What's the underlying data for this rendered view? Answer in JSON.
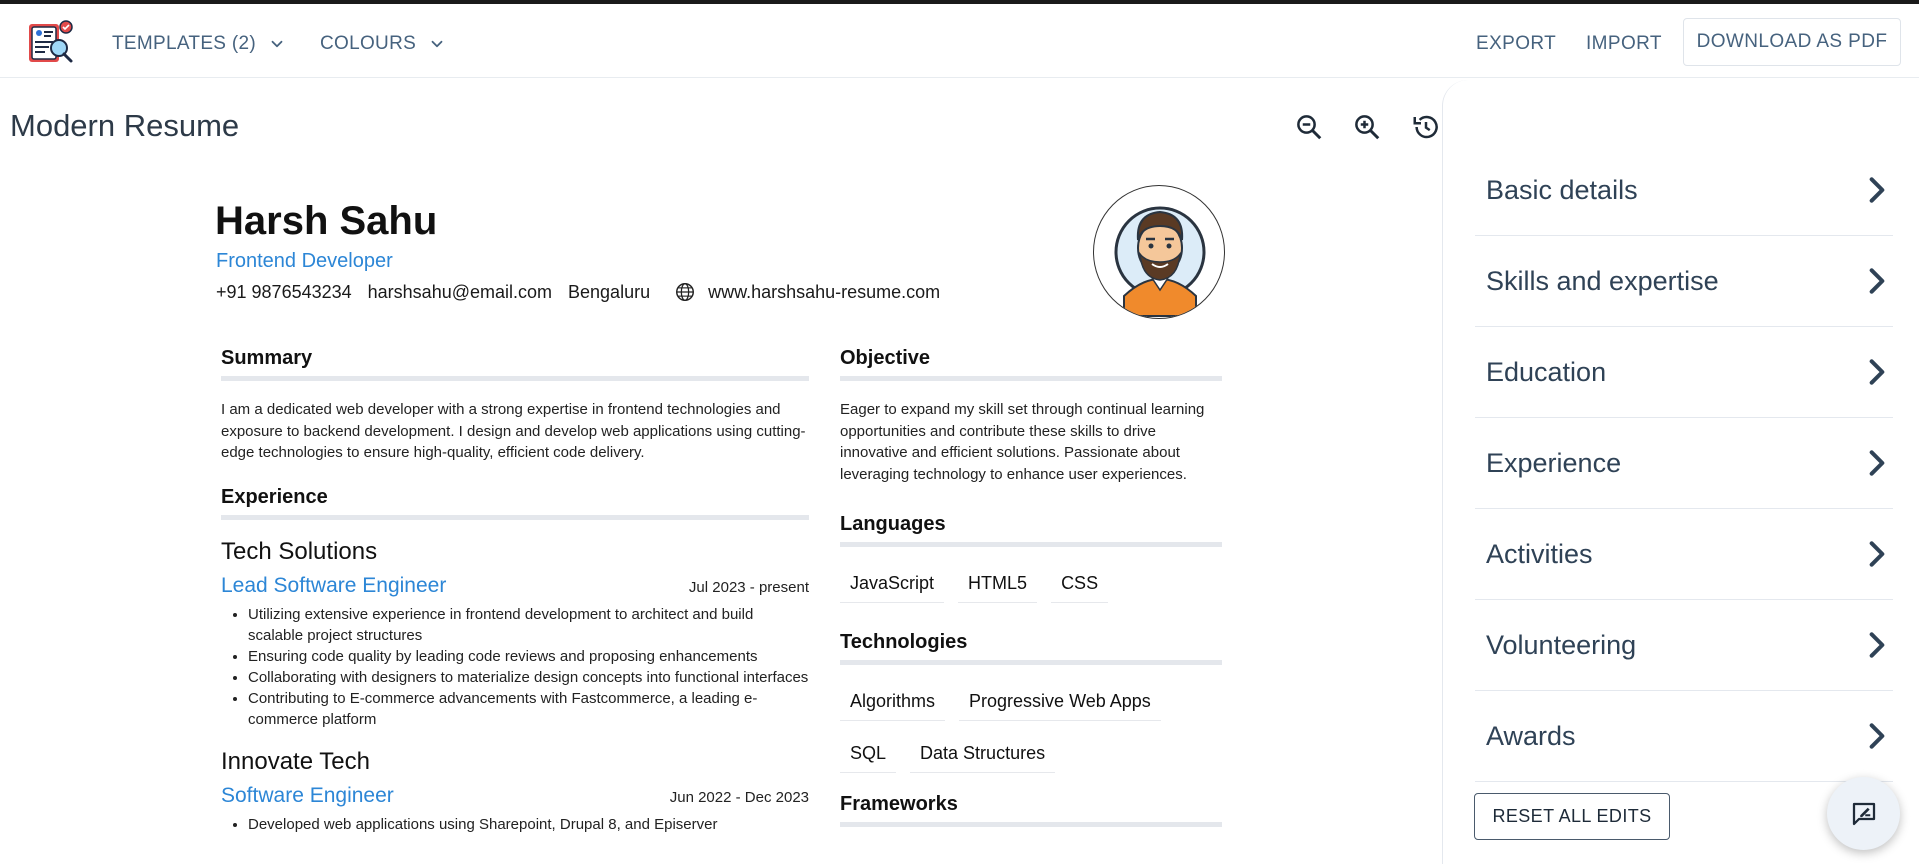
{
  "header": {
    "templates_label": "TEMPLATES (2)",
    "colours_label": "COLOURS",
    "export_label": "EXPORT",
    "import_label": "IMPORT",
    "download_label": "DOWNLOAD AS PDF"
  },
  "page": {
    "title": "Modern Resume"
  },
  "resume": {
    "name": "Harsh Sahu",
    "role": "Frontend Developer",
    "phone": "+91 9876543234",
    "email": "harshsahu@email.com",
    "location": "Bengaluru",
    "website": "www.harshsahu-resume.com",
    "summary_heading": "Summary",
    "summary": "I am a dedicated web developer with a strong expertise in frontend technologies and exposure to backend development. I design and develop web applications using cutting-edge technologies to ensure high-quality, efficient code delivery.",
    "experience_heading": "Experience",
    "experience": [
      {
        "company": "Tech Solutions",
        "title": "Lead Software Engineer",
        "dates": "Jul 2023 - present",
        "bullets": [
          "Utilizing extensive experience in frontend development to architect and build scalable project structures",
          "Ensuring code quality by leading code reviews and proposing enhancements",
          "Collaborating with designers to materialize design concepts into functional interfaces",
          "Contributing to E-commerce advancements with Fastcommerce, a leading e-commerce platform"
        ]
      },
      {
        "company": "Innovate Tech",
        "title": "Software Engineer",
        "dates": "Jun 2022 - Dec 2023",
        "bullets": [
          "Developed web applications using Sharepoint, Drupal 8, and Episerver"
        ]
      }
    ],
    "objective_heading": "Objective",
    "objective": "Eager to expand my skill set through continual learning opportunities and contribute these skills to drive innovative and efficient solutions. Passionate about leveraging technology to enhance user experiences.",
    "languages_heading": "Languages",
    "languages": [
      "JavaScript",
      "HTML5",
      "CSS"
    ],
    "technologies_heading": "Technologies",
    "technologies": [
      "Algorithms",
      "Progressive Web Apps",
      "SQL",
      "Data Structures"
    ],
    "frameworks_heading": "Frameworks"
  },
  "panel": {
    "items": [
      "Basic details",
      "Skills and expertise",
      "Education",
      "Experience",
      "Activities",
      "Volunteering",
      "Awards"
    ],
    "reset_label": "RESET ALL EDITS"
  },
  "colors": {
    "accent_blue": "#2c86d6",
    "nav_text": "#46627e",
    "panel_text": "#2f4256"
  }
}
